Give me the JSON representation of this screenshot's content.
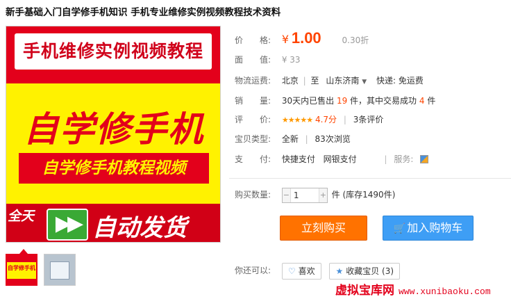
{
  "title": "新手基础入门自学修手机知识 手机专业维修实例视频教程技术资料",
  "image": {
    "top_text": "手机维修实例视频教程",
    "big_text": "自学修手机",
    "sub_text": "自学修手机教程视频",
    "all_day": "全天",
    "auto_text": "自动发货",
    "thumb1_text": "自学修手机"
  },
  "info": {
    "price_label": "价　　格:",
    "currency": "¥",
    "price": "1.00",
    "discount": "0.30折",
    "face_label": "面　　值:",
    "face_value": "¥ 33",
    "logistics_label": "物流运费:",
    "from": "北京",
    "to_word": "至",
    "to": "山东济南",
    "delivery": "快递: 免运费",
    "sales_label": "销　　量:",
    "sales_prefix": "30天内已售出",
    "sales_count": "19",
    "sales_mid": "件，其中交易成功",
    "success_count": "4",
    "sales_suffix": "件",
    "rating_label": "评　　价:",
    "stars": "★★★★★",
    "score": "4.7分",
    "reviews": "3条评价",
    "type_label": "宝贝类型:",
    "type_value": "全新",
    "views": "83次浏览",
    "pay_label": "支　　付:",
    "pay1": "快捷支付",
    "pay2": "网银支付",
    "service_label": "服务:"
  },
  "purchase": {
    "qty_label": "购买数量:",
    "qty_value": "1",
    "minus": "−",
    "plus": "+",
    "stock_text": "件 (库存1490件)",
    "buy_label": "立刻购买",
    "cart_label": "加入购物车"
  },
  "social": {
    "label": "你还可以:",
    "like_label": "喜欢",
    "fav_label": "收藏宝贝",
    "fav_count": "(3)"
  },
  "watermark": {
    "cn": "虚拟宝库网",
    "en": "www.xunibaoku.com"
  },
  "colors": {
    "accent": "#ff4400",
    "buy": "#ff7200",
    "cart": "#3e9ef5",
    "image_red": "#e3001b",
    "image_yellow": "#fff200"
  }
}
